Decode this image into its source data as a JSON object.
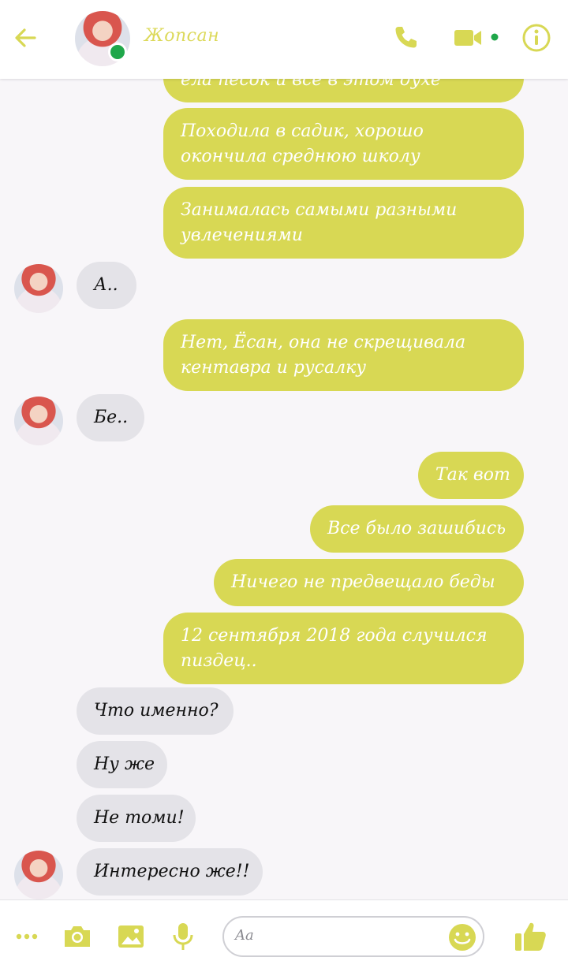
{
  "header": {
    "contact_name": "Жопсан",
    "online": true,
    "icons": [
      "back-arrow-icon",
      "phone-icon",
      "video-camera-icon",
      "info-icon"
    ]
  },
  "accent_color": "#d8d854",
  "messages": [
    {
      "dir": "out",
      "text": "ела песок и все в этом духе"
    },
    {
      "dir": "out",
      "text": "Походила в садик, хорошо окончила среднюю школу"
    },
    {
      "dir": "out",
      "text": "Занималась самыми разными увлечениями"
    },
    {
      "dir": "in",
      "text": "А.."
    },
    {
      "dir": "out",
      "text": "Нет, Ёсан, она не скрещивала кентавра и русалку"
    },
    {
      "dir": "in",
      "text": "Бе.."
    },
    {
      "dir": "out",
      "text": "Так вот"
    },
    {
      "dir": "out",
      "text": "Все было зашибись"
    },
    {
      "dir": "out",
      "text": "Ничего не предвещало беды"
    },
    {
      "dir": "out",
      "text": "12 сентября 2018 года случился пиздец.."
    },
    {
      "dir": "in",
      "text": "Что именно?"
    },
    {
      "dir": "in",
      "text": "Ну же"
    },
    {
      "dir": "in",
      "text": "Не томи!"
    },
    {
      "dir": "in",
      "text": "Интересно же!!"
    }
  ],
  "composer": {
    "placeholder": "Aa",
    "tools": [
      "more-dots-icon",
      "camera-icon",
      "image-icon",
      "microphone-icon",
      "emoji-icon",
      "thumbs-up-icon"
    ]
  }
}
